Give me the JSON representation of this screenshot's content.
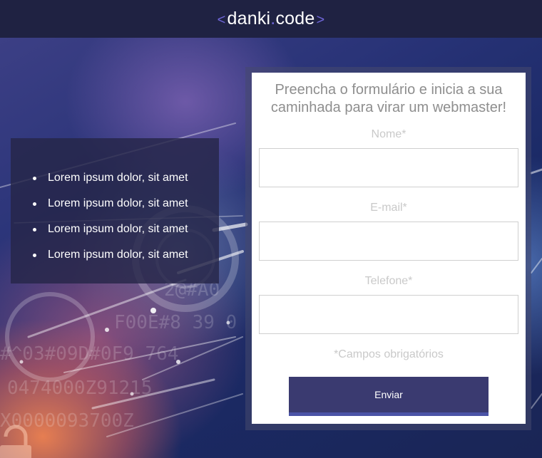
{
  "header": {
    "logo_left_bracket": "<",
    "logo_word_1": "danki",
    "logo_dot": ".",
    "logo_word_2": "code",
    "logo_right_bracket": ">"
  },
  "hero": {
    "background_description_icon": "padlock-icon",
    "features": [
      {
        "label": "Lorem ipsum dolor, sit amet"
      },
      {
        "label": "Lorem ipsum dolor, sit amet"
      },
      {
        "label": "Lorem ipsum dolor, sit amet"
      },
      {
        "label": "Lorem ipsum dolor, sit amet"
      }
    ]
  },
  "form": {
    "title_line_1": "Preencha o formulário e inicia a sua",
    "title_line_2": "caminhada para virar um webmaster!",
    "fields": [
      {
        "label": "Nome*",
        "value": "",
        "placeholder": ""
      },
      {
        "label": "E-mail*",
        "value": "",
        "placeholder": ""
      },
      {
        "label": "Telefone*",
        "value": "",
        "placeholder": ""
      }
    ],
    "required_note": "*Campos obrigatórios",
    "submit_label": "Enviar"
  },
  "colors": {
    "header_bg": "#1f2242",
    "accent": "#6f66d9",
    "button_bg": "#3a3a70",
    "button_border": "#4b53a6"
  }
}
